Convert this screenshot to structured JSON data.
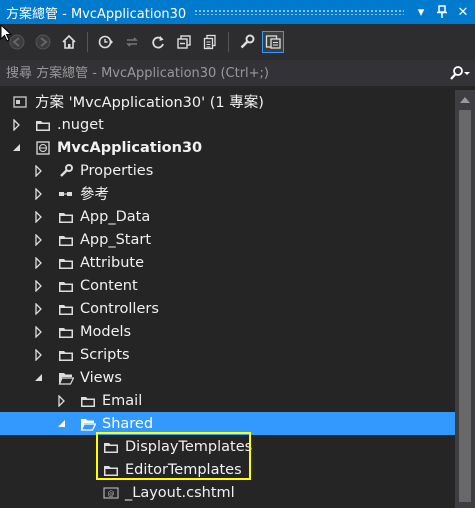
{
  "window": {
    "title": "方案總管 - MvcApplication30",
    "dropdown_glyph": "▾",
    "pin_glyph": "⊥",
    "close_glyph": "✕"
  },
  "toolbar": {
    "buttons": [
      "back-icon",
      "forward-icon",
      "home-icon",
      "history-icon",
      "sync-icon",
      "refresh-icon",
      "collapse-all-icon",
      "show-all-files-icon",
      "properties-icon",
      "preview-icon"
    ]
  },
  "search": {
    "placeholder": "搜尋 方案總管 - MvcApplication30 (Ctrl+;)"
  },
  "tree": {
    "solution": "方案 'MvcApplication30' (1 專案)",
    "nuget": ".nuget",
    "project": "MvcApplication30",
    "properties": "Properties",
    "references": "參考",
    "app_data": "App_Data",
    "app_start": "App_Start",
    "attribute": "Attribute",
    "content": "Content",
    "controllers": "Controllers",
    "models": "Models",
    "scripts": "Scripts",
    "views": "Views",
    "email": "Email",
    "shared": "Shared",
    "display_templates": "DisplayTemplates",
    "editor_templates": "EditorTemplates",
    "layout": "_Layout.cshtml"
  },
  "colors": {
    "accent": "#007acc",
    "selection": "#3399ff",
    "highlight_box": "#ffff00",
    "background": "#252526"
  }
}
